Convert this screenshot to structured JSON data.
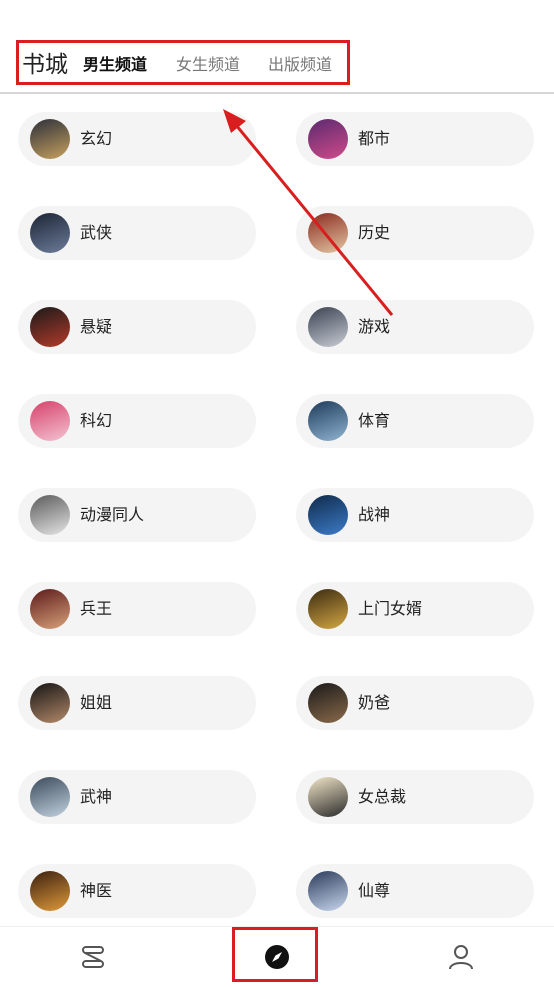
{
  "header": {
    "title": "书城",
    "tabs": [
      {
        "label": "男生频道",
        "active": true
      },
      {
        "label": "女生频道",
        "active": false
      },
      {
        "label": "出版频道",
        "active": false
      }
    ]
  },
  "categories": [
    {
      "label": "玄幻",
      "colors": [
        "#2b2f3a",
        "#c7a15e"
      ]
    },
    {
      "label": "都市",
      "colors": [
        "#5b2a6e",
        "#d04a8a"
      ]
    },
    {
      "label": "武侠",
      "colors": [
        "#1c2535",
        "#6d7c9a"
      ]
    },
    {
      "label": "历史",
      "colors": [
        "#8a2a1e",
        "#e3c7a3"
      ]
    },
    {
      "label": "悬疑",
      "colors": [
        "#1a1a1a",
        "#b43a2a"
      ]
    },
    {
      "label": "游戏",
      "colors": [
        "#3b4150",
        "#c8cdd6"
      ]
    },
    {
      "label": "科幻",
      "colors": [
        "#d7416b",
        "#f3c4d2"
      ]
    },
    {
      "label": "体育",
      "colors": [
        "#1e3b5a",
        "#8fb4d2"
      ]
    },
    {
      "label": "动漫同人",
      "colors": [
        "#5a5a5a",
        "#e6e6e6"
      ]
    },
    {
      "label": "战神",
      "colors": [
        "#0f2a4a",
        "#3d7cc9"
      ]
    },
    {
      "label": "兵王",
      "colors": [
        "#5a1a1a",
        "#d9a27a"
      ]
    },
    {
      "label": "上门女婿",
      "colors": [
        "#3a2a10",
        "#d5a844"
      ]
    },
    {
      "label": "姐姐",
      "colors": [
        "#141414",
        "#b48a6a"
      ]
    },
    {
      "label": "奶爸",
      "colors": [
        "#1a1a1a",
        "#8a6a4a"
      ]
    },
    {
      "label": "武神",
      "colors": [
        "#3a4a5a",
        "#c3d2e0"
      ]
    },
    {
      "label": "女总裁",
      "colors": [
        "#f3e7c9",
        "#2a2a2a"
      ]
    },
    {
      "label": "神医",
      "colors": [
        "#3a2010",
        "#e09a3a"
      ]
    },
    {
      "label": "仙尊",
      "colors": [
        "#2a3a5a",
        "#c9d8ee"
      ]
    }
  ],
  "bottom_nav": [
    {
      "icon": "bookshelf-icon"
    },
    {
      "icon": "compass-icon",
      "active": true
    },
    {
      "icon": "profile-icon"
    }
  ],
  "annotation_color": "#d81e1e"
}
